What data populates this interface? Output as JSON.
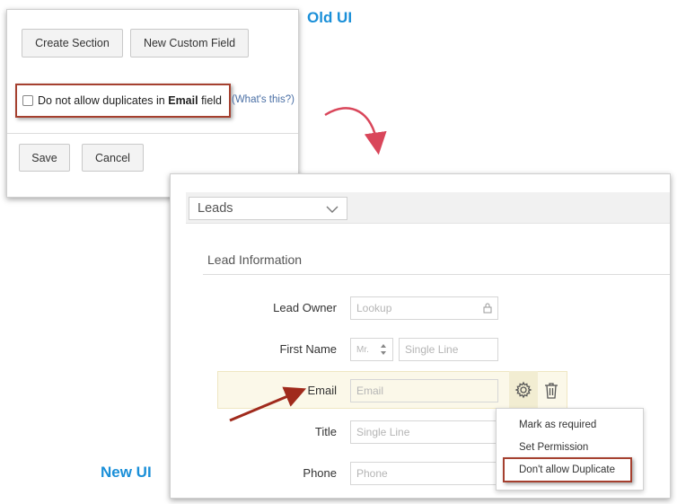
{
  "captions": {
    "old_ui": "Old UI",
    "new_ui": "New UI"
  },
  "old_ui": {
    "create_section_label": "Create Section",
    "new_custom_field_label": "New Custom Field",
    "duplicate_checkbox": {
      "prefix": "Do not allow duplicates in ",
      "field": "Email",
      "suffix": " field",
      "checked": false
    },
    "whats_this_link": "(What's this?)",
    "save_label": "Save",
    "cancel_label": "Cancel"
  },
  "new_ui": {
    "module_select": "Leads",
    "section_title": "Lead Information",
    "fields": [
      {
        "label": "Lead Owner",
        "placeholder": "Lookup"
      },
      {
        "label": "First Name",
        "salutation": "Mr.",
        "placeholder": "Single Line"
      },
      {
        "label": "Email",
        "placeholder": "Email"
      },
      {
        "label": "Title",
        "placeholder": "Single Line"
      },
      {
        "label": "Phone",
        "placeholder": "Phone"
      }
    ],
    "menu": {
      "items": [
        "Mark as required",
        "Set Permission",
        "Don't allow Duplicate"
      ]
    }
  },
  "colors": {
    "caption_blue": "#1a8fd8",
    "highlight_red": "#a5402f",
    "arrow_pink": "#d9465a",
    "arrow_red": "#a02a1c",
    "row_highlight": "#fbf8e9"
  },
  "icons": [
    "lock-icon",
    "updown-icon",
    "gear-icon",
    "trash-icon",
    "chevron-down-icon"
  ]
}
